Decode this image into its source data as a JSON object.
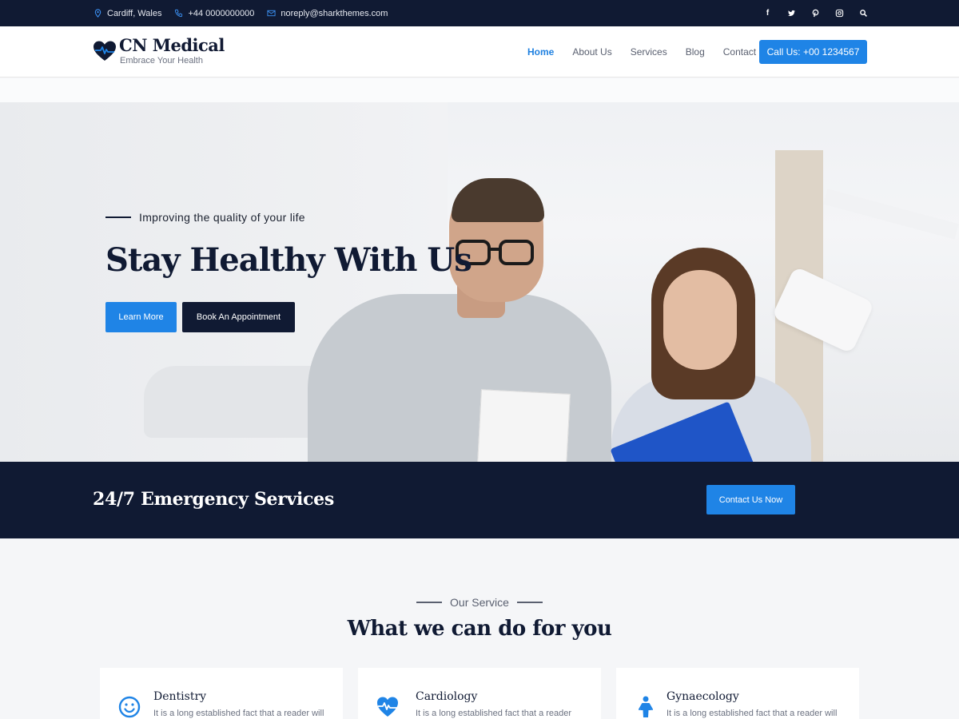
{
  "topbar": {
    "location": "Cardiff, Wales",
    "phone": "+44 0000000000",
    "email": "noreply@sharkthemes.com",
    "social": [
      "facebook",
      "twitter",
      "pinterest",
      "instagram",
      "search"
    ]
  },
  "header": {
    "brand": "CN Medical",
    "tagline": "Embrace Your Health",
    "nav": [
      "Home",
      "About Us",
      "Services",
      "Blog",
      "Contact"
    ],
    "active_nav": "Home",
    "call_button": "Call Us: +00 1234567"
  },
  "hero": {
    "subtitle": "Improving the quality of your life",
    "title": "Stay Healthy With Us",
    "primary_button": "Learn More",
    "secondary_button": "Book An Appointment"
  },
  "emergency": {
    "title": "24/7 Emergency Services",
    "button": "Contact Us Now"
  },
  "services": {
    "kicker": "Our Service",
    "title": "What we can do for you",
    "cards": [
      {
        "name": "Dentistry",
        "desc": "It is a long established fact that a reader will",
        "icon": "smile-icon"
      },
      {
        "name": "Cardiology",
        "desc": "It is a long established fact that a reader",
        "icon": "heartbeat-icon"
      },
      {
        "name": "Gynaecology",
        "desc": "It is a long established fact that a reader will",
        "icon": "female-icon"
      }
    ]
  },
  "colors": {
    "navy": "#101a33",
    "accent": "#1f84e6",
    "background": "#f5f6f8"
  }
}
